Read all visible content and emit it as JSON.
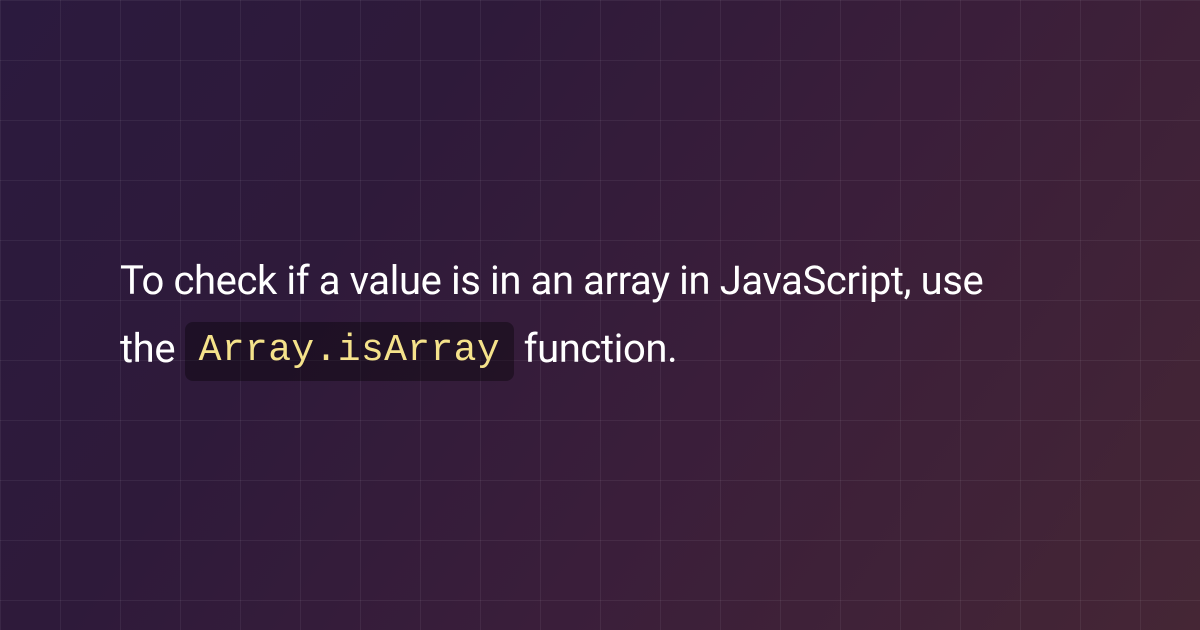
{
  "headline": {
    "prefix": "To check if a value is in an array in JavaScript, use the ",
    "code": "Array.isArray",
    "suffix": " function."
  }
}
